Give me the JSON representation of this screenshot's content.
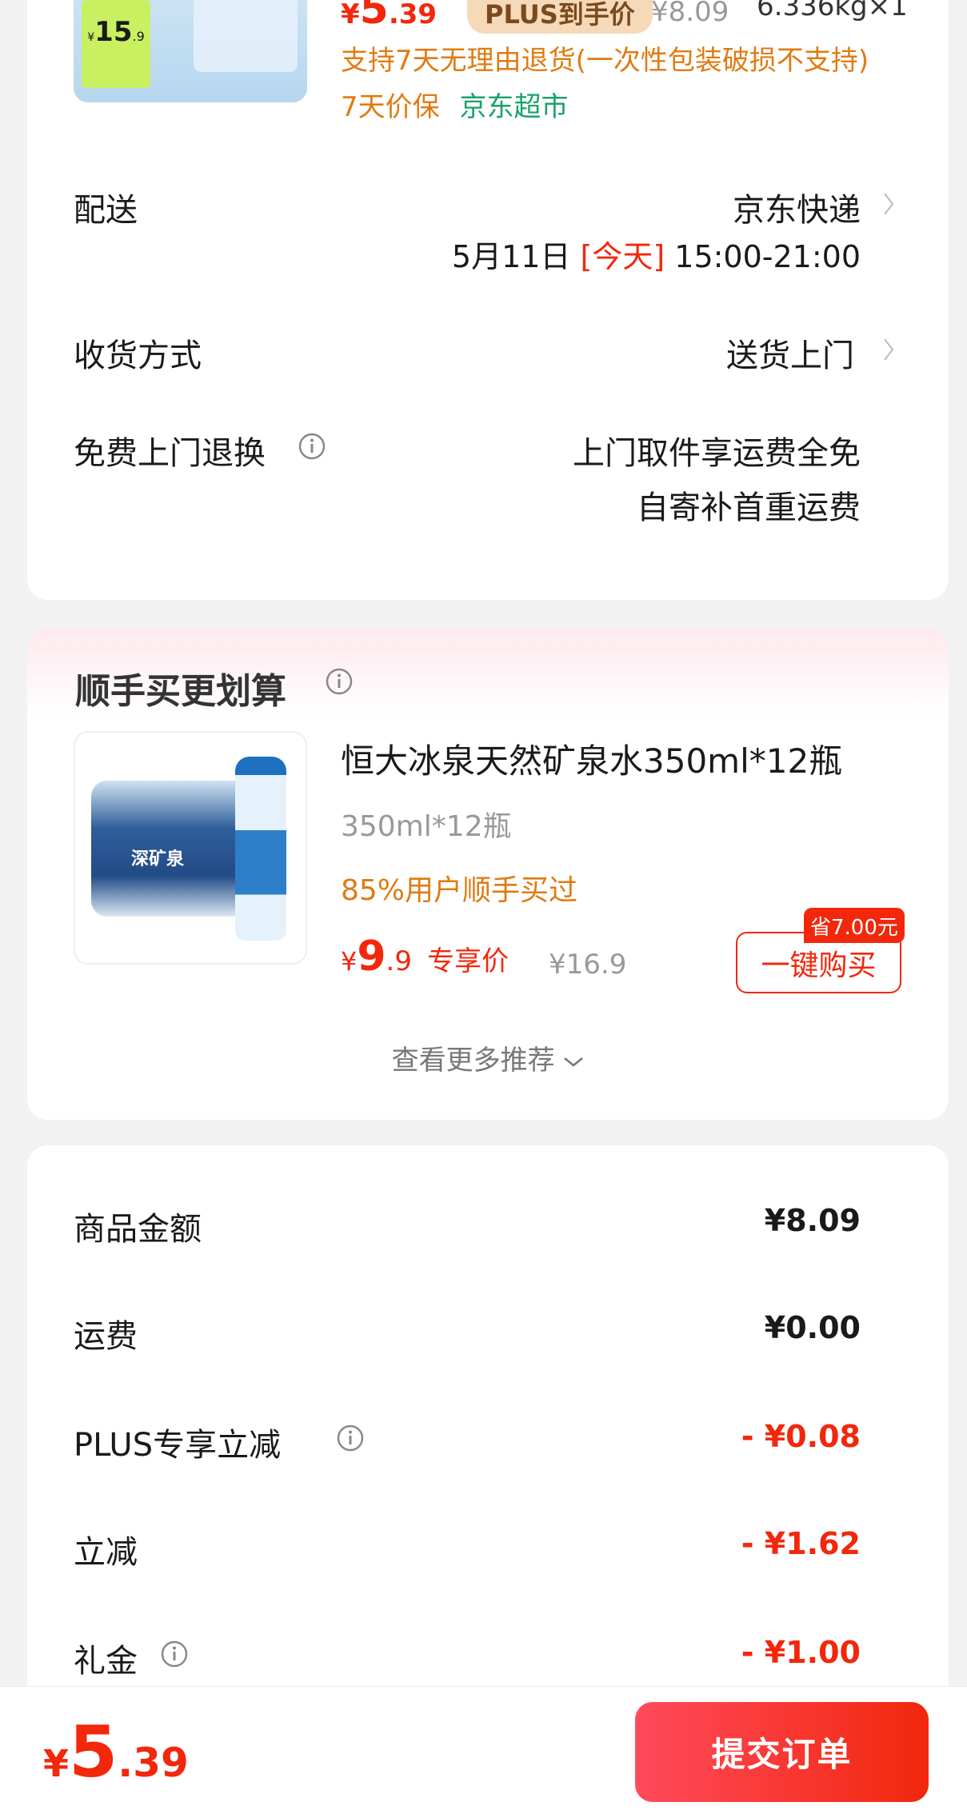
{
  "product": {
    "price_currency": "¥",
    "price_int": "5",
    "price_dec": ".39",
    "plus_tag": "PLUS到手价",
    "orig_price": "¥8.09",
    "weight_qty": "6.336kg×1",
    "thumb_price_label": "¥",
    "thumb_price_big": "15",
    "thumb_price_small": ".9",
    "return_policy": "支持7天无理由退货(一次性包装破损不支持)",
    "price_protect": "7天价保",
    "store": "京东超市"
  },
  "delivery": {
    "label": "配送",
    "method": "京东快递",
    "date": "5月11日",
    "today": "[今天]",
    "time": "15:00-21:00"
  },
  "receive": {
    "label": "收货方式",
    "value": "送货上门"
  },
  "free_return": {
    "label": "免费上门退换",
    "line1": "上门取件享运费全免",
    "line2": "自寄补首重运费"
  },
  "recommend": {
    "title": "顺手买更划算",
    "name": "恒大冰泉天然矿泉水350ml*12瓶",
    "spec": "350ml*12瓶",
    "bought": "85%用户顺手买过",
    "price_currency": "¥",
    "price_int": "9",
    "price_dec": ".9",
    "price_label": "专享价",
    "orig_price": "¥16.9",
    "save_tag": "省7.00元",
    "buy_button": "一键购买",
    "more": "查看更多推荐",
    "bottle_label": "深矿泉"
  },
  "summary": {
    "rows": [
      {
        "label": "商品金额",
        "value": "¥8.09"
      },
      {
        "label": "运费",
        "value": "¥0.00"
      },
      {
        "label": "PLUS专享立减",
        "value": "- ¥0.08"
      },
      {
        "label": "立减",
        "value": "- ¥1.62"
      },
      {
        "label": "礼金",
        "value": "- ¥1.00"
      }
    ]
  },
  "footer": {
    "currency": "¥",
    "total_int": "5",
    "total_dec": ".39",
    "submit": "提交订单"
  },
  "colors": {
    "accent": "#f2270c",
    "orange": "#e07b12",
    "green": "#1aa26a"
  }
}
